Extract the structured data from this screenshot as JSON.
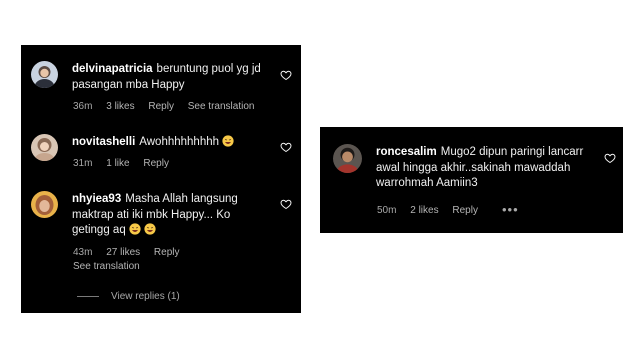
{
  "left_comments": [
    {
      "username": "delvinapatricia",
      "text": "beruntung puol yg jd pasangan mba Happy",
      "time": "36m",
      "likes": "3 likes",
      "reply": "Reply",
      "translation": "See translation",
      "icon": "heart-outline-icon"
    },
    {
      "username": "novitashelli",
      "text": "Awohhhhhhhhh",
      "time": "31m",
      "likes": "1 like",
      "reply": "Reply",
      "icon": "heart-outline-icon"
    },
    {
      "username": "nhyiea93",
      "text": "Masha Allah langsung maktrap ati iki mbk Happy... Ko getingg aq",
      "time": "43m",
      "likes": "27 likes",
      "reply": "Reply",
      "translation": "See translation",
      "icon": "heart-outline-icon"
    }
  ],
  "view_replies": "View replies (1)",
  "right_comment": {
    "username": "roncesalim",
    "text": "Mugo2 dipun paringi lancarr awal hingga akhir..sakinah mawaddah warrohmah Aamiin3",
    "time": "50m",
    "likes": "2 likes",
    "reply": "Reply",
    "more": "•••",
    "icon": "heart-outline-icon"
  },
  "colors": {
    "background": "#000000",
    "primary_text": "#f5f5f5",
    "secondary_text": "#a8a8a8",
    "emoji": "#f7c948"
  }
}
